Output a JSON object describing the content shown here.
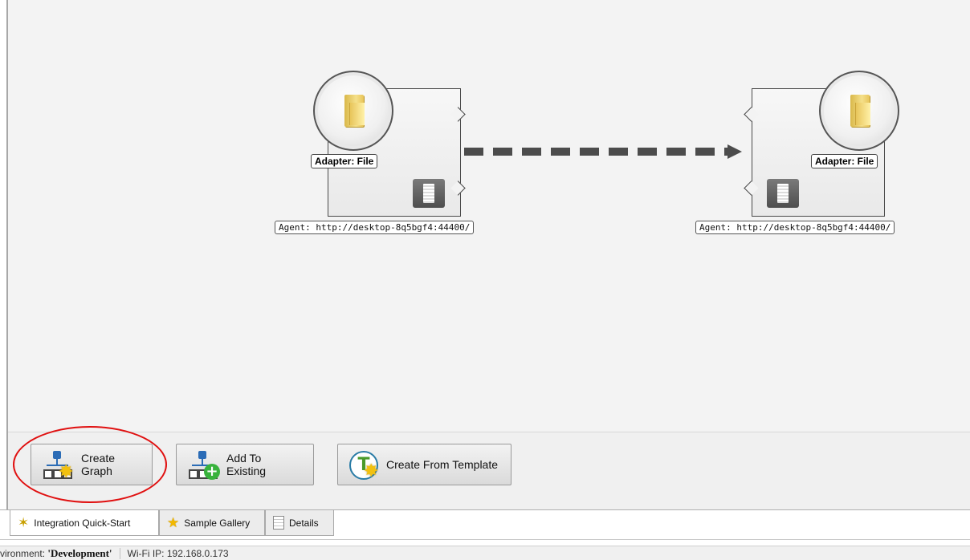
{
  "canvas": {
    "source_node": {
      "adapter_label": "Adapter: File",
      "agent_label": "Agent: http://desktop-8q5bgf4:44400/",
      "icon": "folder-icon"
    },
    "target_node": {
      "adapter_label": "Adapter: File",
      "agent_label": "Agent: http://desktop-8q5bgf4:44400/",
      "icon": "folder-icon"
    }
  },
  "actions": {
    "create_graph": "Create Graph",
    "add_to_existing": "Add To Existing",
    "create_from_template": "Create From Template",
    "template_icon_letter": "T"
  },
  "tabs": [
    {
      "label": "Integration Quick-Start",
      "icon": "magic-wand-icon",
      "active": true
    },
    {
      "label": "Sample Gallery",
      "icon": "star-icon",
      "active": false
    },
    {
      "label": "Details",
      "icon": "document-icon",
      "active": false
    }
  ],
  "status": {
    "environment_prefix": "vironment: ",
    "environment_value": "'Development'",
    "wifi": "Wi-Fi IP: 192.168.0.173"
  },
  "colors": {
    "highlight_circle": "#e01010",
    "connector": "#4c4c4c"
  }
}
